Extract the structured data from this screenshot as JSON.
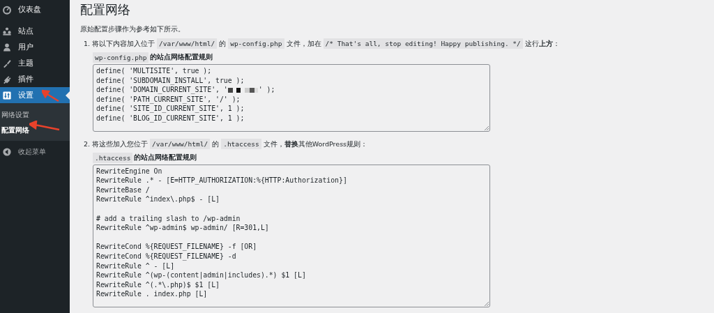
{
  "sidebar": {
    "items": [
      {
        "label": "仪表盘",
        "selected": false
      },
      {
        "label": "站点",
        "selected": false
      },
      {
        "label": "用户",
        "selected": false
      },
      {
        "label": "主题",
        "selected": false
      },
      {
        "label": "插件",
        "selected": false
      },
      {
        "label": "设置",
        "selected": true,
        "children": [
          {
            "label": "网络设置",
            "selected": false
          },
          {
            "label": "配置网络",
            "selected": true
          }
        ]
      }
    ],
    "collapse": {
      "label": "收起菜单"
    }
  },
  "page": {
    "title": "配置网络",
    "intro": "原始配置步骤作为参考如下所示。",
    "steps": [
      {
        "number": "1.",
        "parts": [
          {
            "kind": "text",
            "text": "将以下内容加入位于"
          },
          {
            "kind": "code",
            "text": "/var/www/html/"
          },
          {
            "kind": "text",
            "text": "的"
          },
          {
            "kind": "code",
            "text": "wp-config.php"
          },
          {
            "kind": "text",
            "text": "文件，加在"
          },
          {
            "kind": "code",
            "text": "/* That's all, stop editing! Happy publishing. */"
          },
          {
            "kind": "text",
            "text": "这行"
          },
          {
            "kind": "bold",
            "text": "上方"
          },
          {
            "kind": "text",
            "text": "："
          }
        ],
        "caption": {
          "code": "wp-config.php",
          "text": "的站点网络配置规则"
        },
        "lines": [
          {
            "kind": "plain",
            "text": "define( 'MULTISITE', true );"
          },
          {
            "kind": "plain",
            "text": "define( 'SUBDOMAIN_INSTALL', true );"
          },
          {
            "kind": "redacted",
            "text": "define( 'DOMAIN_CURRENT_SITE', '",
            "after": "' );"
          },
          {
            "kind": "plain",
            "text": "define( 'PATH_CURRENT_SITE', '/' );"
          },
          {
            "kind": "plain",
            "text": "define( 'SITE_ID_CURRENT_SITE', 1 );"
          },
          {
            "kind": "plain",
            "text": "define( 'BLOG_ID_CURRENT_SITE', 1 );"
          }
        ]
      },
      {
        "number": "2.",
        "parts": [
          {
            "kind": "text",
            "text": "将这些加入您位于"
          },
          {
            "kind": "code",
            "text": "/var/www/html/"
          },
          {
            "kind": "text",
            "text": "的"
          },
          {
            "kind": "code",
            "text": ".htaccess"
          },
          {
            "kind": "text",
            "text": "文件，"
          },
          {
            "kind": "bold",
            "text": "替换"
          },
          {
            "kind": "text",
            "text": "其他WordPress规则："
          }
        ],
        "caption": {
          "code": ".htaccess",
          "text": "的站点网络配置规则"
        },
        "lines": [
          {
            "kind": "plain",
            "text": "RewriteEngine On"
          },
          {
            "kind": "plain",
            "text": "RewriteRule .* - [E=HTTP_AUTHORIZATION:%{HTTP:Authorization}]"
          },
          {
            "kind": "plain",
            "text": "RewriteBase /"
          },
          {
            "kind": "plain",
            "text": "RewriteRule ^index\\.php$ - [L]"
          },
          {
            "kind": "blank"
          },
          {
            "kind": "plain",
            "text": "# add a trailing slash to /wp-admin"
          },
          {
            "kind": "plain",
            "text": "RewriteRule ^wp-admin$ wp-admin/ [R=301,L]"
          },
          {
            "kind": "blank"
          },
          {
            "kind": "plain",
            "text": "RewriteCond %{REQUEST_FILENAME} -f [OR]"
          },
          {
            "kind": "plain",
            "text": "RewriteCond %{REQUEST_FILENAME} -d"
          },
          {
            "kind": "plain",
            "text": "RewriteRule ^ - [L]"
          },
          {
            "kind": "plain",
            "text": "RewriteRule ^(wp-(content|admin|includes).*) $1 [L]"
          },
          {
            "kind": "plain",
            "text": "RewriteRule ^(.*\\.php)$ $1 [L]"
          },
          {
            "kind": "plain",
            "text": "RewriteRule . index.php [L]"
          }
        ]
      }
    ]
  },
  "annotations": [
    {
      "kind": "arrow"
    },
    {
      "kind": "arrow"
    }
  ]
}
